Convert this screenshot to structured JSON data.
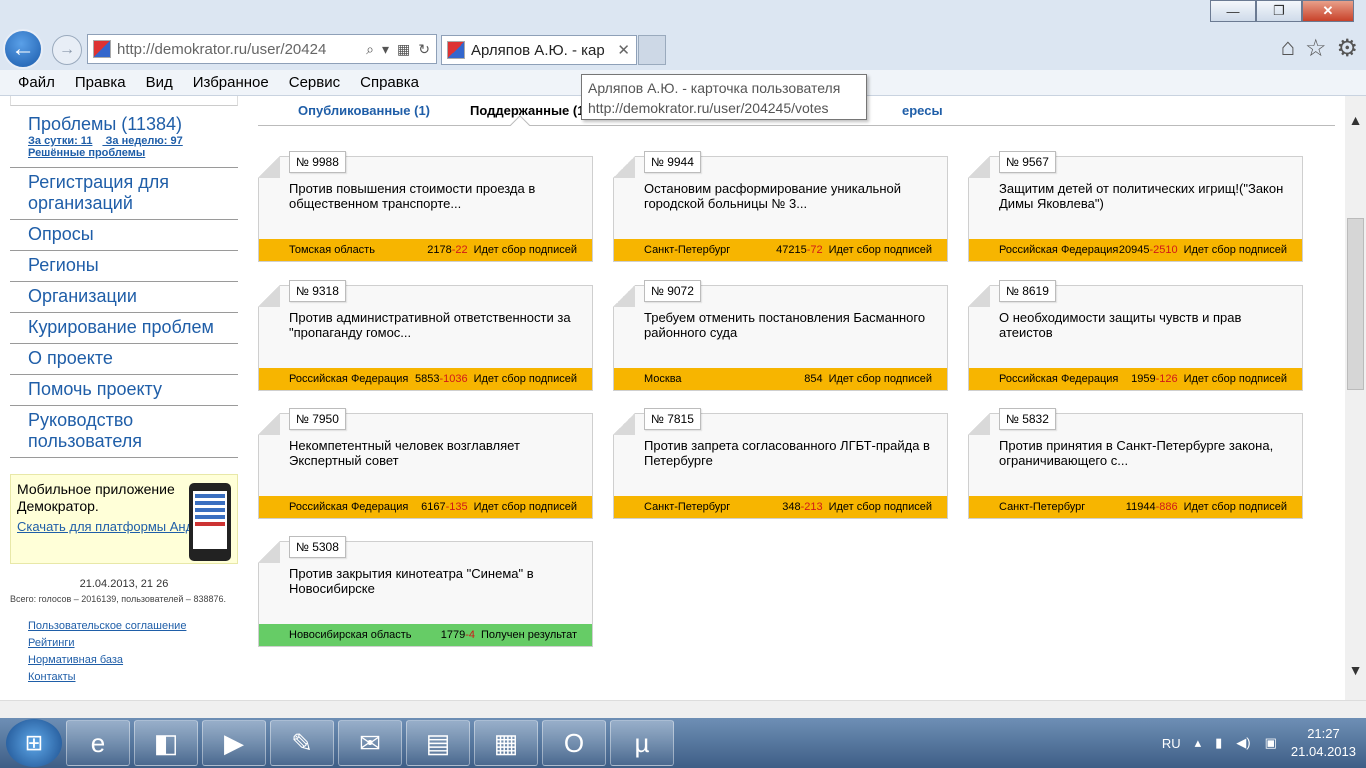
{
  "browser": {
    "address": "http://demokrator.ru/user/20424",
    "tab_title": "Арляпов А.Ю. - кар",
    "window_buttons": {
      "minimize": "—",
      "maximize": "❐",
      "close": "✕"
    },
    "menu": [
      "Файл",
      "Правка",
      "Вид",
      "Избранное",
      "Сервис",
      "Справка"
    ]
  },
  "tooltip": {
    "title": "Арляпов А.Ю. - карточка пользователя",
    "url": "http://demokrator.ru/user/204245/votes"
  },
  "sidebar": {
    "problems": {
      "label": "Проблемы (11384)",
      "day": "За сутки: 11",
      "week": "За неделю: 97",
      "solved": "Решённые проблемы"
    },
    "items": [
      "Регистрация для организаций",
      "Опросы",
      "Регионы",
      "Организации",
      "Курирование проблем",
      "О проекте",
      "Помочь проекту",
      "Руководство пользователя"
    ],
    "mobile": {
      "title": "Мобильное приложение Демократор.",
      "link": "Скачать для платформы Андроид."
    },
    "stats": {
      "date": "21.04.2013, 21 26",
      "total": "Всего: голосов – 2016139, пользователей – 838876."
    },
    "footer_links": [
      "Пользовательское соглашение",
      "Рейтинги",
      "Нормативная база",
      "Контакты"
    ]
  },
  "content_tabs": {
    "published": "Опубликованные (1)",
    "supported": "Поддержанные (10)",
    "interests": "ересы"
  },
  "cards": [
    {
      "num": "№ 9988",
      "title": "Против повышения стоимости проезда в общественном транспорте...",
      "region": "Томская область",
      "votes": "2178",
      "plus": "-22",
      "status": "Идет сбор подписей",
      "color": "#f7b500"
    },
    {
      "num": "№ 9944",
      "title": "Остановим расформирование уникальной городской больницы № 3...",
      "region": "Санкт-Петербург",
      "votes": "47215",
      "plus": "-72",
      "status": "Идет сбор подписей",
      "color": "#f7b500"
    },
    {
      "num": "№ 9567",
      "title": "Защитим детей от политических игрищ!(\"Закон Димы Яковлева\")",
      "region": "Российская Федерация",
      "votes": "20945",
      "plus": "-2510",
      "status": "Идет сбор подписей",
      "color": "#f7b500"
    },
    {
      "num": "№ 9318",
      "title": "Против административной ответственности за \"пропаганду гомос...",
      "region": "Российская Федерация",
      "votes": "5853",
      "plus": "-1036",
      "status": "Идет сбор подписей",
      "color": "#f7b500"
    },
    {
      "num": "№ 9072",
      "title": "Требуем отменить постановления Басманного районного суда",
      "region": "Москва",
      "votes": "854",
      "plus": "",
      "status": "Идет сбор подписей",
      "color": "#f7b500"
    },
    {
      "num": "№ 8619",
      "title": "О необходимости защиты чувств и прав атеистов",
      "region": "Российская Федерация",
      "votes": "1959",
      "plus": "-126",
      "status": "Идет сбор подписей",
      "color": "#f7b500"
    },
    {
      "num": "№ 7950",
      "title": "Некомпетентный человек возглавляет Экспертный совет",
      "region": "Российская Федерация",
      "votes": "6167",
      "plus": "-135",
      "status": "Идет сбор подписей",
      "color": "#f7b500"
    },
    {
      "num": "№ 7815",
      "title": "Против запрета согласованного ЛГБТ-прайда в Петербурге",
      "region": "Санкт-Петербург",
      "votes": "348",
      "plus": "-213",
      "status": "Идет сбор подписей",
      "color": "#f7b500"
    },
    {
      "num": "№ 5832",
      "title": "Против принятия в Санкт-Петербурге закона, ограничивающего с...",
      "region": "Санкт-Петербург",
      "votes": "11944",
      "plus": "-886",
      "status": "Идет сбор подписей",
      "color": "#f7b500"
    },
    {
      "num": "№ 5308",
      "title": "Против закрытия кинотеатра \"Синема\" в Новосибирске",
      "region": "Новосибирская область",
      "votes": "1779",
      "plus": "-4",
      "status": "Получен результат",
      "color": "#66cc66"
    }
  ],
  "taskbar": {
    "lang": "RU",
    "time": "21:27",
    "date": "21.04.2013",
    "apps": [
      "ie-icon",
      "remote-desktop-icon",
      "media-player-icon",
      "network-tool-icon",
      "mail-icon",
      "explorer-icon",
      "calculator-icon",
      "opera-icon",
      "utorrent-icon"
    ]
  }
}
